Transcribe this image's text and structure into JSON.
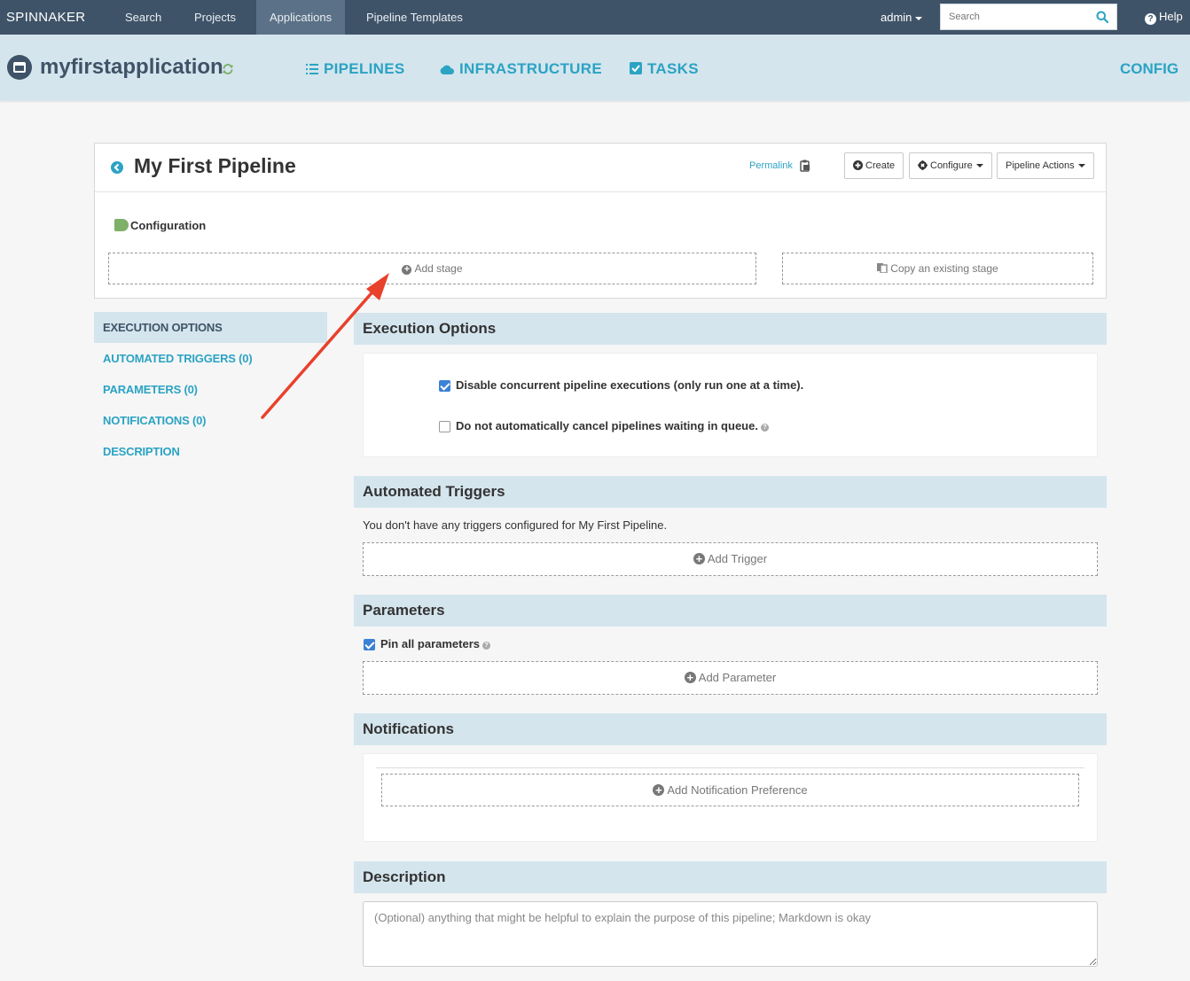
{
  "topnav": {
    "brand": "SPINNAKER",
    "links": [
      "Search",
      "Projects",
      "Applications",
      "Pipeline Templates"
    ],
    "user": "admin",
    "search_placeholder": "Search",
    "help": "Help"
  },
  "appbar": {
    "app_name": "myfirstapplication",
    "tabs": [
      "PIPELINES",
      "INFRASTRUCTURE",
      "TASKS"
    ],
    "config": "CONFIG"
  },
  "pipeline": {
    "title": "My First Pipeline",
    "permalink": "Permalink",
    "create": "Create",
    "configure": "Configure",
    "actions": "Pipeline Actions",
    "config_node": "Configuration",
    "add_stage": "Add stage",
    "copy_stage": "Copy an existing stage"
  },
  "sidenav": {
    "items": [
      "EXECUTION OPTIONS",
      "AUTOMATED TRIGGERS (0)",
      "PARAMETERS (0)",
      "NOTIFICATIONS (0)",
      "DESCRIPTION"
    ]
  },
  "execution": {
    "heading": "Execution Options",
    "opt1": "Disable concurrent pipeline executions (only run one at a time).",
    "opt1_checked": true,
    "opt2": "Do not automatically cancel pipelines waiting in queue.",
    "opt2_checked": false
  },
  "triggers": {
    "heading": "Automated Triggers",
    "empty": "You don't have any triggers configured for My First Pipeline.",
    "add": "Add Trigger"
  },
  "parameters": {
    "heading": "Parameters",
    "pin_label": "Pin all parameters",
    "pin_checked": true,
    "add": "Add Parameter"
  },
  "notifications": {
    "heading": "Notifications",
    "add": "Add Notification Preference"
  },
  "description": {
    "heading": "Description",
    "placeholder": "(Optional) anything that might be helpful to explain the purpose of this pipeline; Markdown is okay"
  },
  "colors": {
    "topnav": "#3f5368",
    "accent": "#2ba3c3",
    "section_bg": "#d4e5ed",
    "annotation_arrow": "#e8412c"
  }
}
